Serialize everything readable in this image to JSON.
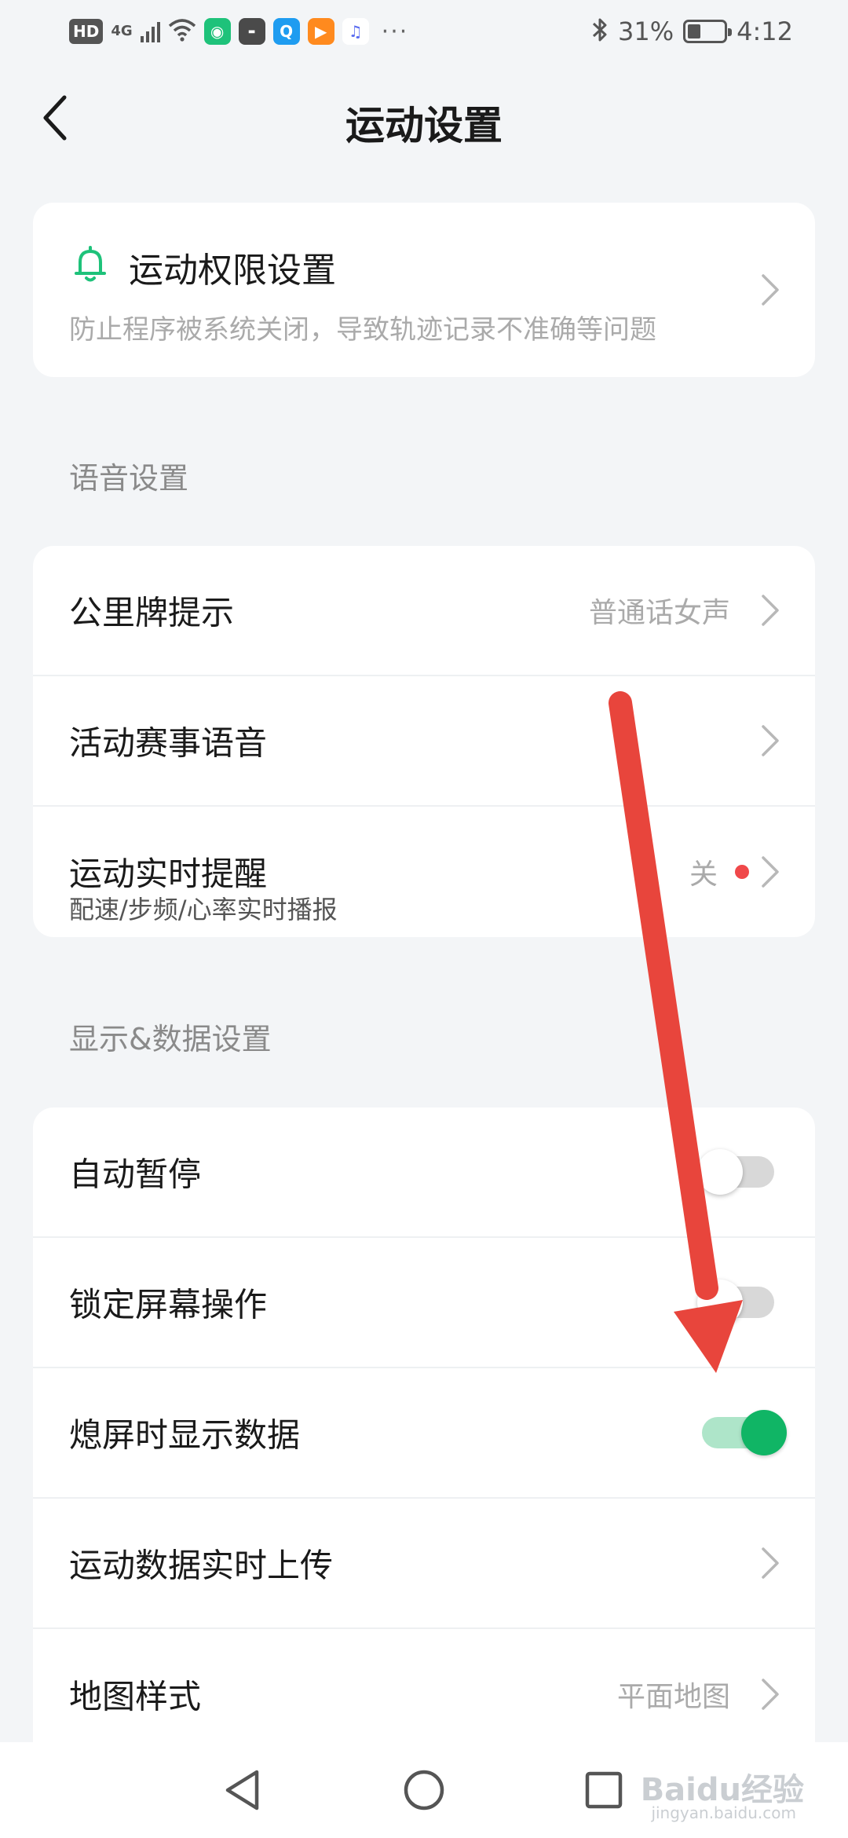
{
  "status_bar": {
    "hd": "HD",
    "network": "4G",
    "battery_percent": "31%",
    "time": "4:12",
    "more": "···"
  },
  "header": {
    "title": "运动设置"
  },
  "permission_card": {
    "title": "运动权限设置",
    "subtitle": "防止程序被系统关闭，导致轨迹记录不准确等问题"
  },
  "voice_section": {
    "title": "语音设置",
    "rows": [
      {
        "label": "公里牌提示",
        "value": "普通话女声"
      },
      {
        "label": "活动赛事语音",
        "value": ""
      },
      {
        "label": "运动实时提醒",
        "subtitle": "配速/步频/心率实时播报",
        "value": "关"
      }
    ]
  },
  "display_section": {
    "title": "显示&数据设置",
    "rows": [
      {
        "label": "自动暂停",
        "toggle": false
      },
      {
        "label": "锁定屏幕操作",
        "toggle": false
      },
      {
        "label": "熄屏时显示数据",
        "toggle": true
      },
      {
        "label": "运动数据实时上传"
      },
      {
        "label": "地图样式",
        "value": "平面地图"
      }
    ]
  },
  "watermark": {
    "text": "Baidu经验",
    "sub": "jingyan.baidu.com"
  },
  "colors": {
    "accent_green": "#10b565",
    "toggle_on_track": "#aee5c9",
    "red_dot": "#f0484a",
    "annotation_arrow": "#e8453c"
  }
}
